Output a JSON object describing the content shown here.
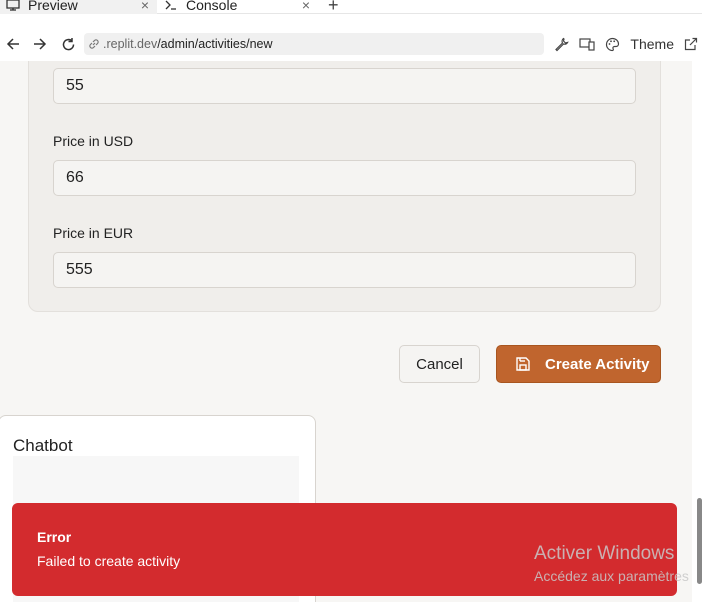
{
  "browser": {
    "tabs": [
      {
        "label": "Preview",
        "icon": "monitor-icon",
        "active": true
      },
      {
        "label": "Console",
        "icon": "terminal-icon",
        "active": false
      }
    ],
    "close_glyph": "×",
    "new_tab_glyph": "+",
    "url": {
      "host": ".replit.dev",
      "path": "/admin/activities/new"
    },
    "theme_label": "Theme"
  },
  "form": {
    "first_value": "55",
    "price_usd": {
      "label": "Price in USD",
      "value": "66"
    },
    "price_eur": {
      "label": "Price in EUR",
      "value": "555"
    },
    "cancel_label": "Cancel",
    "create_label": "Create Activity"
  },
  "chatbot": {
    "title": "Chatbot"
  },
  "toast": {
    "title": "Error",
    "message": "Failed to create activity",
    "color": "#d32b2e"
  },
  "watermark": {
    "line1": "Activer Windows",
    "line2": "Accédez aux paramètres"
  },
  "colors": {
    "accent": "#c0652e",
    "error": "#d32b2e"
  }
}
